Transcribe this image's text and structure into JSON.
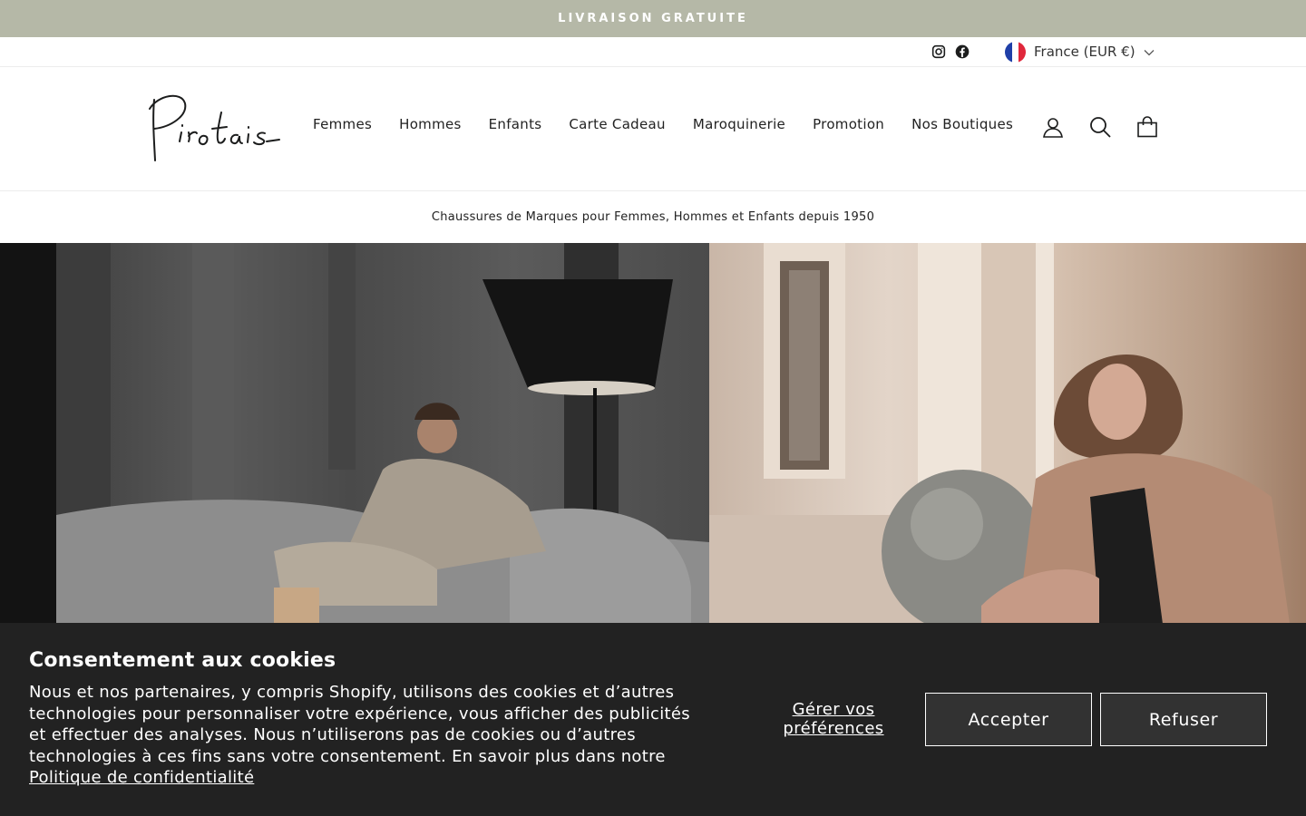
{
  "announcement": {
    "text": "LIVRAISON GRATUITE"
  },
  "toolbar": {
    "social": [
      "instagram-icon",
      "facebook-icon"
    ],
    "locale_label": "France (EUR €)"
  },
  "header": {
    "logo_text": "Pirotais",
    "nav": [
      "Femmes",
      "Hommes",
      "Enfants",
      "Carte Cadeau",
      "Maroquinerie",
      "Promotion",
      "Nos Boutiques"
    ],
    "icons": [
      "account-icon",
      "search-icon",
      "cart-icon"
    ]
  },
  "tagline": "Chaussures de Marques pour Femmes, Hommes et Enfants depuis 1950",
  "cookie": {
    "title": "Consentement aux cookies",
    "body": "Nous et nos partenaires, y compris Shopify, utilisons des cookies et d’autres technologies pour personnaliser votre expérience, vous afficher des publicités et effectuer des analyses. Nous n’utiliserons pas de cookies ou d’autres technologies à ces fins sans votre consentement. En savoir plus dans notre ",
    "policy_link": "Politique de confidentialité",
    "manage_label": "Gérer vos préférences",
    "accept_label": "Accepter",
    "refuse_label": "Refuser"
  },
  "colors": {
    "announcement_bg": "#b5b8a7",
    "cookie_bg": "#222222",
    "button_bg": "#323232"
  }
}
